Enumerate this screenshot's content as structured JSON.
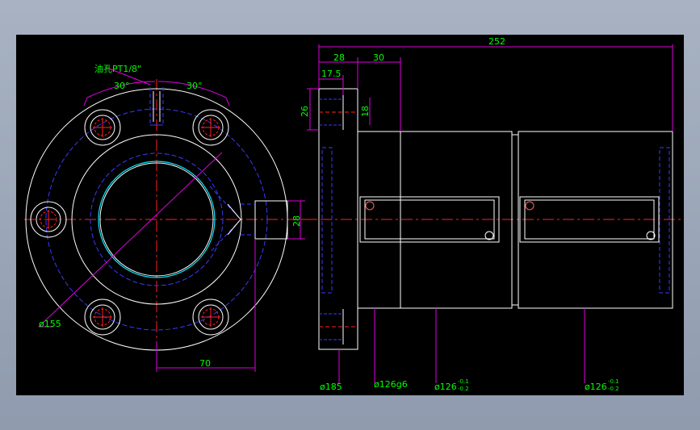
{
  "drawing": {
    "colors": {
      "background": "#000000",
      "outline": "#ffffff",
      "hidden_line": "#3a3aff",
      "center_line": "#ff2020",
      "dimension": "#e000e0",
      "text": "#00ff00",
      "bore": "#00e5ff"
    },
    "front_view": {
      "port_note": "油孔PT1/8\"",
      "angle_left": "30°",
      "angle_right": "30°",
      "dia_flange": "ø155",
      "dim_70": "70",
      "dim_28_side": "28"
    },
    "side_view": {
      "dim_total": "252",
      "dim_28_top": "28",
      "dim_30": "30",
      "dim_17_5": "17.5",
      "dim_26": "26",
      "dim_18": "18",
      "dia_185": "ø185",
      "dia_126g6": "ø126g6",
      "dia_126_a": "ø126",
      "dia_126_b": "ø126",
      "tol_upper": "-0.1",
      "tol_lower": "-0.2"
    }
  }
}
